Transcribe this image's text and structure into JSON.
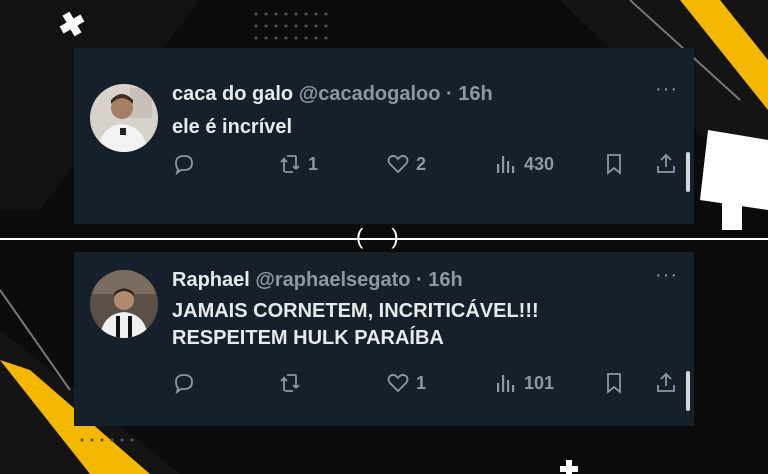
{
  "theme": {
    "accent": "#f5b800",
    "card_bg": "#15202b",
    "muted": "#8b98a5",
    "text": "#e7e9ea"
  },
  "tweets": [
    {
      "display_name": "caca do galo",
      "handle": "@cacadogaloo",
      "time": "16h",
      "text_lines": [
        "ele é incrível"
      ],
      "reply_count": "",
      "retweet_count": "1",
      "like_count": "2",
      "view_count": "430"
    },
    {
      "display_name": "Raphael",
      "handle": "@raphaelsegato",
      "time": "16h",
      "text_lines": [
        "JAMAIS CORNETEM, INCRITICÁVEL!!!",
        "RESPEITEM HULK PARAÍBA"
      ],
      "reply_count": "",
      "retweet_count": "",
      "like_count": "1",
      "view_count": "101"
    }
  ],
  "separator": {
    "dot": "·",
    "more": "···"
  }
}
